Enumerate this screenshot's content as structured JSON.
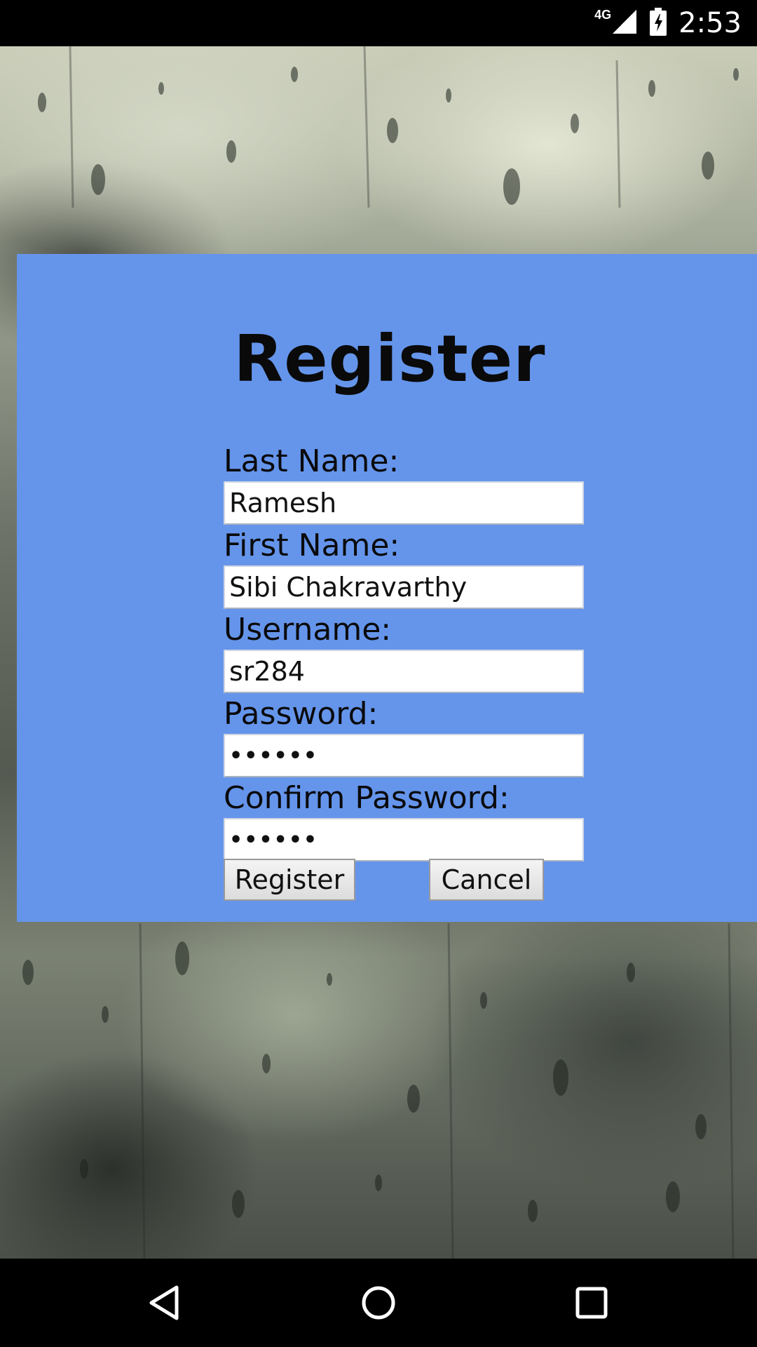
{
  "status_bar": {
    "network": "4G",
    "time": "2:53"
  },
  "form": {
    "title": "Register",
    "fields": [
      {
        "label": "Last Name:",
        "value": "Ramesh",
        "type": "text"
      },
      {
        "label": "First Name:",
        "value": "Sibi Chakravarthy",
        "type": "text"
      },
      {
        "label": "Username:",
        "value": "sr284",
        "type": "text"
      },
      {
        "label": "Password:",
        "value": "••••••",
        "type": "password"
      },
      {
        "label": "Confirm Password:",
        "value": "••••••",
        "type": "password"
      }
    ],
    "register_label": "Register",
    "cancel_label": "Cancel"
  },
  "colors": {
    "panel": "#6595eb",
    "status_bar": "#000000"
  },
  "icons": {
    "signal": "cell-signal-icon",
    "battery": "battery-charging-icon",
    "back": "back-icon",
    "home": "home-icon",
    "recent": "recent-apps-icon"
  }
}
